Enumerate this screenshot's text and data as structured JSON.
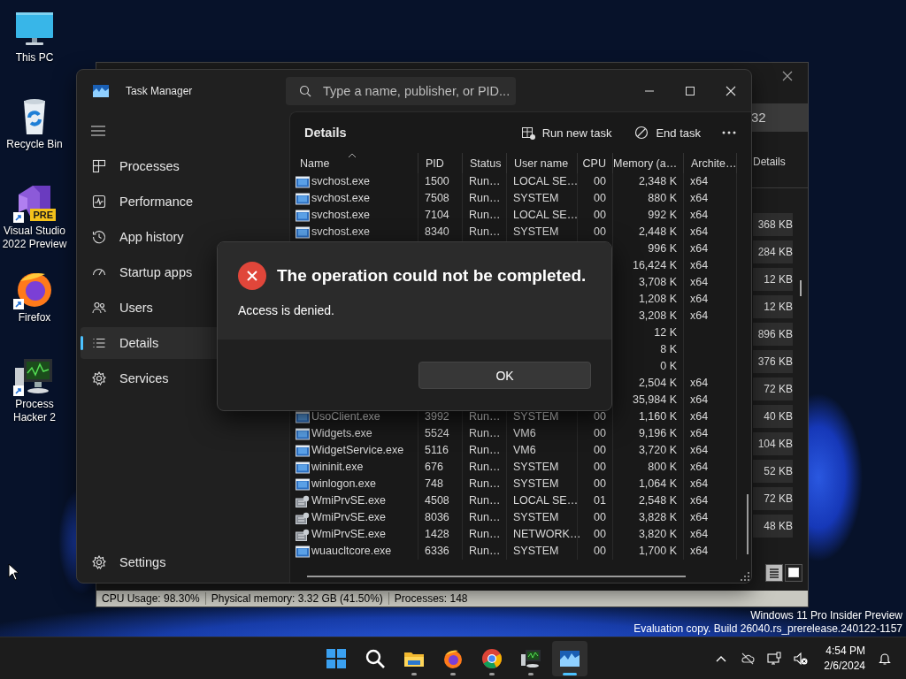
{
  "desktop_icons": [
    {
      "label": "This PC",
      "kind": "monitor",
      "shortcut": false
    },
    {
      "label": "Recycle Bin",
      "kind": "bin",
      "shortcut": false
    },
    {
      "label": "Visual Studio 2022 Preview",
      "kind": "ribbon",
      "badge": "PRE",
      "shortcut": true
    },
    {
      "label": "Firefox",
      "kind": "flame",
      "shortcut": true
    },
    {
      "label": "Process Hacker 2",
      "kind": "computer",
      "shortcut": true
    }
  ],
  "background_window": {
    "search_value": "32",
    "tab": "Details",
    "sizes": [
      "368 KB",
      "284 KB",
      "12 KB",
      "12 KB",
      "896 KB",
      "376 KB",
      "72 KB",
      "40 KB",
      "104 KB",
      "52 KB",
      "72 KB",
      "48 KB"
    ],
    "view_buttons": [
      {
        "kind": "list",
        "selected": true
      },
      {
        "kind": "tiles",
        "selected": false
      }
    ],
    "status_bar": [
      "CPU Usage: 98.30%",
      "Physical memory: 3.32 GB (41.50%)",
      "Processes: 148"
    ]
  },
  "task_manager": {
    "title": "Task Manager",
    "search": {
      "placeholder": "Type a name, publisher, or PID..."
    },
    "sidebar": {
      "items": [
        {
          "label": "Processes",
          "kind": "processes",
          "selected": false
        },
        {
          "label": "Performance",
          "kind": "performance",
          "selected": false
        },
        {
          "label": "App history",
          "kind": "history",
          "selected": false
        },
        {
          "label": "Startup apps",
          "kind": "startup",
          "selected": false
        },
        {
          "label": "Users",
          "kind": "users",
          "selected": false
        },
        {
          "label": "Details",
          "kind": "details",
          "selected": true
        },
        {
          "label": "Services",
          "kind": "services",
          "selected": false
        }
      ],
      "settings": "Settings"
    },
    "page_title": "Details",
    "actions": [
      {
        "label": "Run new task",
        "kind": "run"
      },
      {
        "label": "End task",
        "kind": "end"
      }
    ],
    "table": {
      "columns": [
        {
          "label": "Name",
          "sorted": true
        },
        {
          "label": "PID",
          "sorted": false
        },
        {
          "label": "Status",
          "sorted": false
        },
        {
          "label": "User name",
          "sorted": false
        },
        {
          "label": "CPU",
          "sorted": false
        },
        {
          "label": "Memory (a…",
          "sorted": false
        },
        {
          "label": "Archite…",
          "sorted": false
        }
      ],
      "rows": [
        {
          "kind": "app",
          "name": "svchost.exe",
          "pid": "1500",
          "status": "Run…",
          "user": "LOCAL SE…",
          "cpu": "00",
          "memory": "2,348 K",
          "arch": "x64"
        },
        {
          "kind": "app",
          "name": "svchost.exe",
          "pid": "7508",
          "status": "Run…",
          "user": "SYSTEM",
          "cpu": "00",
          "memory": "880 K",
          "arch": "x64"
        },
        {
          "kind": "app",
          "name": "svchost.exe",
          "pid": "7104",
          "status": "Run…",
          "user": "LOCAL SE…",
          "cpu": "00",
          "memory": "992 K",
          "arch": "x64"
        },
        {
          "kind": "app",
          "name": "svchost.exe",
          "pid": "8340",
          "status": "Run…",
          "user": "SYSTEM",
          "cpu": "00",
          "memory": "2,448 K",
          "arch": "x64"
        },
        {
          "memory": "996 K",
          "arch": "x64"
        },
        {
          "memory": "16,424 K",
          "arch": "x64"
        },
        {
          "memory": "3,708 K",
          "arch": "x64"
        },
        {
          "memory": "1,208 K",
          "arch": "x64"
        },
        {
          "memory": "3,208 K",
          "arch": "x64"
        },
        {
          "memory": "12 K"
        },
        {
          "memory": "8 K"
        },
        {
          "memory": "0 K"
        },
        {
          "memory": "2,504 K",
          "arch": "x64"
        },
        {
          "memory": "35,984 K",
          "arch": "x64"
        },
        {
          "kind": "app",
          "name": "UsoClient.exe",
          "pid": "3992",
          "status": "Run…",
          "user": "SYSTEM",
          "cpu": "00",
          "memory": "1,160 K",
          "arch": "x64"
        },
        {
          "kind": "app",
          "name": "Widgets.exe",
          "pid": "5524",
          "status": "Run…",
          "user": "VM6",
          "cpu": "00",
          "memory": "9,196 K",
          "arch": "x64"
        },
        {
          "kind": "app",
          "name": "WidgetService.exe",
          "pid": "5116",
          "status": "Run…",
          "user": "VM6",
          "cpu": "00",
          "memory": "3,720 K",
          "arch": "x64"
        },
        {
          "kind": "app",
          "name": "wininit.exe",
          "pid": "676",
          "status": "Run…",
          "user": "SYSTEM",
          "cpu": "00",
          "memory": "800 K",
          "arch": "x64"
        },
        {
          "kind": "app",
          "name": "winlogon.exe",
          "pid": "748",
          "status": "Run…",
          "user": "SYSTEM",
          "cpu": "00",
          "memory": "1,064 K",
          "arch": "x64"
        },
        {
          "kind": "wmi",
          "name": "WmiPrvSE.exe",
          "pid": "4508",
          "status": "Run…",
          "user": "LOCAL SE…",
          "cpu": "01",
          "memory": "2,548 K",
          "arch": "x64"
        },
        {
          "kind": "wmi",
          "name": "WmiPrvSE.exe",
          "pid": "8036",
          "status": "Run…",
          "user": "SYSTEM",
          "cpu": "00",
          "memory": "3,828 K",
          "arch": "x64"
        },
        {
          "kind": "wmi",
          "name": "WmiPrvSE.exe",
          "pid": "1428",
          "status": "Run…",
          "user": "NETWORK…",
          "cpu": "00",
          "memory": "3,820 K",
          "arch": "x64"
        },
        {
          "kind": "app",
          "name": "wuaucltcore.exe",
          "pid": "6336",
          "status": "Run…",
          "user": "SYSTEM",
          "cpu": "00",
          "memory": "1,700 K",
          "arch": "x64"
        }
      ]
    }
  },
  "dialog": {
    "title": "The operation could not be completed.",
    "message": "Access is denied.",
    "buttons": [
      "OK"
    ]
  },
  "evaluation_notice": [
    "Windows 11 Pro Insider Preview",
    "Evaluation copy. Build 26040.rs_prerelease.240122-1157"
  ],
  "taskbar": {
    "apps": [
      {
        "kind": "start",
        "running": false,
        "selected": false
      },
      {
        "kind": "search",
        "running": false,
        "selected": false
      },
      {
        "kind": "folder",
        "running": true,
        "selected": false
      },
      {
        "kind": "flame",
        "running": true,
        "selected": false
      },
      {
        "kind": "ring",
        "running": true,
        "selected": false
      },
      {
        "kind": "computer",
        "running": true,
        "selected": false
      },
      {
        "kind": "graph",
        "running": true,
        "selected": true
      }
    ],
    "tray": [
      {
        "kind": "chevron"
      },
      {
        "kind": "cloud-off"
      },
      {
        "kind": "network"
      },
      {
        "kind": "muted"
      }
    ],
    "time": "4:54 PM",
    "date": "2/6/2024"
  }
}
